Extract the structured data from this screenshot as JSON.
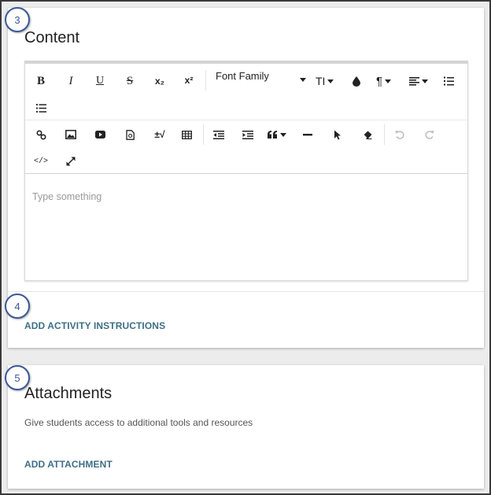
{
  "steps": {
    "content": "3",
    "instructions": "4",
    "attachments": "5"
  },
  "content_section": {
    "title": "Content",
    "editor": {
      "toolbar": {
        "bold": "B",
        "italic": "I",
        "underline": "U",
        "strikethrough": "S",
        "subscript": "x₂",
        "superscript": "x²",
        "font_family": "Font Family",
        "font_size": "TI",
        "paragraph": "¶",
        "special_chars": "±√"
      },
      "placeholder": "Type something"
    },
    "add_instructions_label": "ADD ACTIVITY INSTRUCTIONS"
  },
  "attachments_section": {
    "title": "Attachments",
    "description": "Give students access to additional tools and resources",
    "add_attachment_label": "ADD ATTACHMENT"
  },
  "colors": {
    "badge": "#3b5998",
    "link": "#3d6f86",
    "placeholder": "#9a9a9a"
  }
}
